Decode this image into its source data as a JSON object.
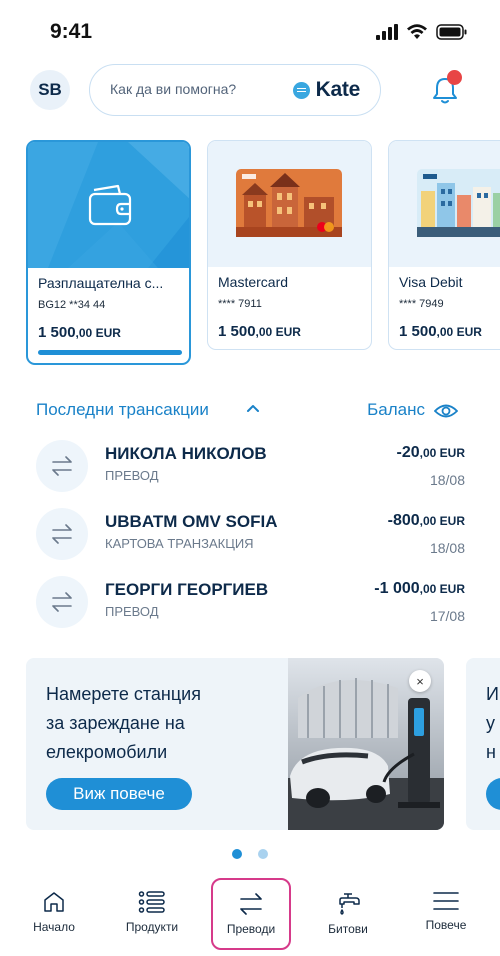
{
  "status": {
    "time": "9:41"
  },
  "header": {
    "avatar_initials": "SB",
    "search_placeholder": "Как да ви помогна?",
    "assistant_name": "Kate",
    "has_notification": true
  },
  "accounts": [
    {
      "title": "Разплащателна с...",
      "number": "BG12 **34 44",
      "amount": "1 500",
      "decimals": ",00",
      "currency": " EUR",
      "selected": true,
      "image": "wallet-icon"
    },
    {
      "title": "Mastercard",
      "number": "**** 7911",
      "amount": "1 500",
      "decimals": ",00",
      "currency": " EUR",
      "selected": false,
      "image": "mastercard-card-image"
    },
    {
      "title": "Visa Debit",
      "number": "**** 7949",
      "amount": "1 500",
      "decimals": ",00",
      "currency": " EUR",
      "selected": false,
      "image": "visa-card-image"
    }
  ],
  "transactions": {
    "title": "Последни трансакции",
    "balance_label": "Баланс",
    "items": [
      {
        "name": "НИКОЛА НИКОЛОВ",
        "type": "ПРЕВОД",
        "amount": "-20",
        "decimals": ",00",
        "currency": " EUR",
        "date": "18/08"
      },
      {
        "name": "UBBATM OMV SOFIA",
        "type": "КАРТОВА ТРАНЗАКЦИЯ",
        "amount": "-800",
        "decimals": ",00",
        "currency": " EUR",
        "date": "18/08"
      },
      {
        "name": "ГЕОРГИ ГЕОРГИЕВ",
        "type": "ПРЕВОД",
        "amount": "-1 000",
        "decimals": ",00",
        "currency": " EUR",
        "date": "17/08"
      }
    ]
  },
  "promo": {
    "lines": [
      "Намерете станция",
      "за зареждане на",
      "елекромобили"
    ],
    "button_label": "Виж повече",
    "close_label": "×",
    "next_lines": [
      "И",
      "у",
      "н"
    ]
  },
  "carousel": {
    "pages": 2,
    "active_page": 1
  },
  "tabbar": {
    "items": [
      {
        "label": "Начало",
        "icon": "home-icon",
        "active": false
      },
      {
        "label": "Продукти",
        "icon": "products-list-icon",
        "active": false
      },
      {
        "label": "Преводи",
        "icon": "transfer-arrows-icon",
        "active": true
      },
      {
        "label": "Битови",
        "icon": "utility-tap-icon",
        "active": false
      },
      {
        "label": "Повече",
        "icon": "menu-icon",
        "active": false
      }
    ]
  },
  "colors": {
    "accent": "#1f8fd6",
    "text_dark": "#0d2a4a",
    "active_tab_border": "#d63a8a",
    "notification_dot": "#e84545"
  }
}
